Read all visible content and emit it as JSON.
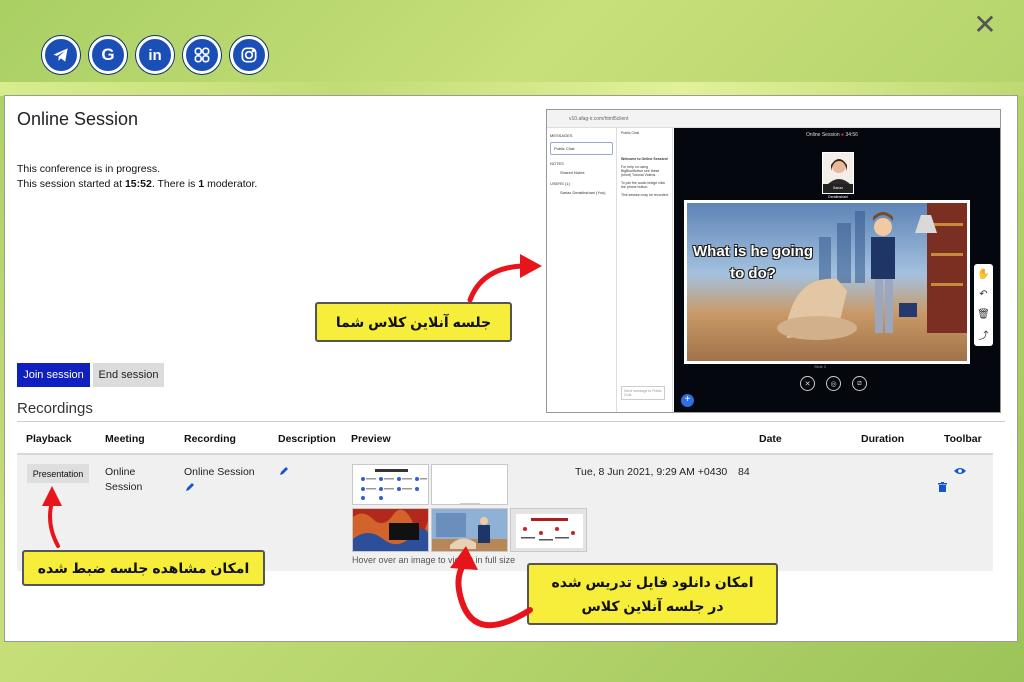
{
  "social_icons": [
    {
      "name": "telegram-icon",
      "glyph": ""
    },
    {
      "name": "google-icon",
      "glyph": "G"
    },
    {
      "name": "linkedin-icon",
      "glyph": "in"
    },
    {
      "name": "app-icon",
      "glyph": ""
    },
    {
      "name": "instagram-icon",
      "glyph": ""
    }
  ],
  "close_glyph": "✕",
  "page": {
    "title": "Online Session",
    "status_line1": "This conference is in progress.",
    "status_prefix": "This session started at ",
    "start_time": "15:52",
    "status_mid": ". There is ",
    "moderator_count": "1",
    "status_suffix": " moderator."
  },
  "buttons": {
    "join": "Join session",
    "end": "End session"
  },
  "recordings": {
    "title": "Recordings",
    "columns": [
      "Playback",
      "Meeting",
      "Recording",
      "Description",
      "Preview",
      "Date",
      "Duration",
      "Toolbar"
    ],
    "row": {
      "playback": "Presentation",
      "meeting": "Online Session",
      "recording": "Online Session",
      "date": "Tue, 8 Jun 2021, 9:29 AM +0430",
      "duration": "84"
    },
    "hint": "Hover over an image to view it in full size"
  },
  "inset": {
    "url": "v10.afag-ir.com/html5client",
    "messages": "MESSAGES",
    "public_chat": "Public Chat",
    "notes": "NOTES",
    "shared_notes": "Shared Notes",
    "users": "USERS (1)",
    "user_name": "Sanaz Derakhshani (You)",
    "chat_header": "Public Chat",
    "chat_welcome": "Welcome to Online Session!",
    "chat_body": "For help on using BigBlueButton see these (short) Tutorial Videos.",
    "chat_audio": "To join the audio bridge click the phone button.",
    "chat_note": "This session may be recorded.",
    "chat_input": "Send message to Public Chat",
    "stage_title": "Online Session",
    "timer": "34:56",
    "cam_name": "Sanaz Derakhshani",
    "slide_text": "What is he going to do?",
    "slide_nav": "Slide 2"
  },
  "callouts": {
    "class_session": "جلسه آنلاین کلاس شما",
    "view_recorded": "امکان مشاهده جلسه ضبط شده",
    "download_line1": "امکان دانلود فایل تدریس شده",
    "download_line2": "در جلسه آنلاین کلاس"
  },
  "colors": {
    "accent": "#0f1fc0",
    "callout": "#f6ee3b",
    "arrow": "#e8141b",
    "social": "#1a4fb8"
  }
}
